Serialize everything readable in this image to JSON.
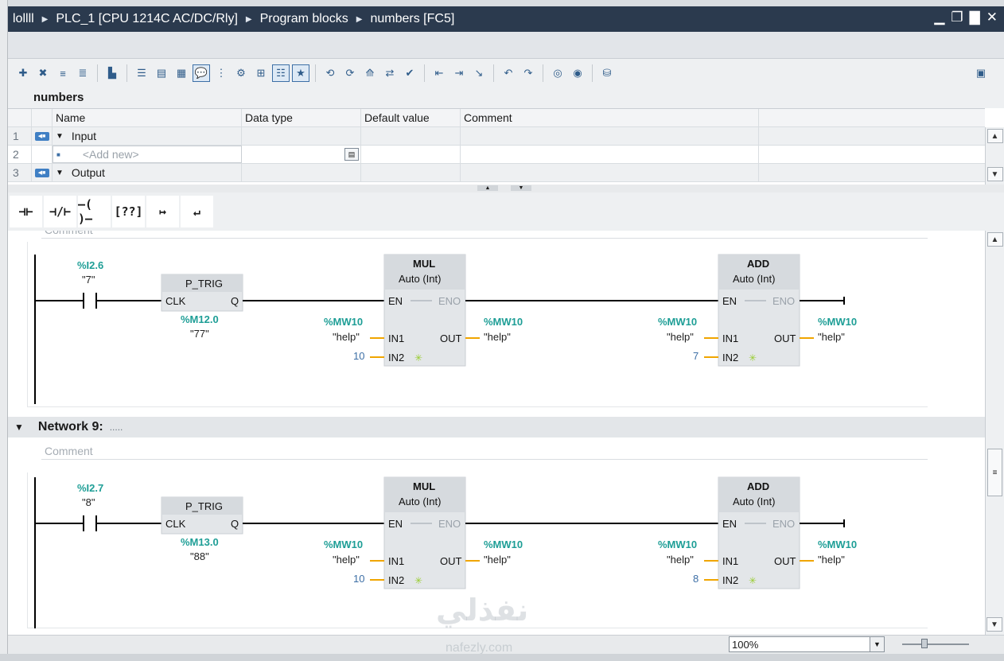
{
  "title_bar": {
    "crumbs": [
      "lollll",
      "PLC_1 [CPU 1214C AC/DC/Rly]",
      "Program blocks",
      "numbers [FC5]"
    ],
    "controls": [
      "▁",
      "❐",
      "▇",
      "✕"
    ]
  },
  "interface": {
    "block_name": "numbers",
    "columns": [
      "Name",
      "Data type",
      "Default value",
      "Comment"
    ],
    "rows": [
      {
        "num": "1",
        "name": "Input",
        "section": true
      },
      {
        "num": "2",
        "name": "<Add new>",
        "section": false
      },
      {
        "num": "3",
        "name": "Output",
        "section": true
      }
    ]
  },
  "favorites": [
    "⊣⊢",
    "⊣/⊢",
    "–( )–",
    "[??]",
    "↦",
    "↵"
  ],
  "network_top": {
    "comment": "Comment",
    "contact": {
      "address": "%I2.6",
      "tag": "\"7\""
    },
    "ptrig": {
      "title": "P_TRIG",
      "clk": "CLK",
      "q": "Q",
      "address": "%M12.0",
      "tag": "\"77\""
    },
    "mul": {
      "title": "MUL",
      "type": "Auto (Int)",
      "en": "EN",
      "eno": "ENO",
      "in1": "IN1",
      "in2": "IN2",
      "out": "OUT",
      "in1_addr": "%MW10",
      "in1_tag": "\"help\"",
      "in2_val": "10",
      "out_addr": "%MW10",
      "out_tag": "\"help\""
    },
    "add": {
      "title": "ADD",
      "type": "Auto (Int)",
      "en": "EN",
      "eno": "ENO",
      "in1": "IN1",
      "in2": "IN2",
      "out": "OUT",
      "in1_addr": "%MW10",
      "in1_tag": "\"help\"",
      "in2_val": "7",
      "out_addr": "%MW10",
      "out_tag": "\"help\""
    }
  },
  "network9": {
    "header": "Network 9:",
    "dots": ".....",
    "comment": "Comment",
    "contact": {
      "address": "%I2.7",
      "tag": "\"8\""
    },
    "ptrig": {
      "title": "P_TRIG",
      "clk": "CLK",
      "q": "Q",
      "address": "%M13.0",
      "tag": "\"88\""
    },
    "mul": {
      "title": "MUL",
      "type": "Auto (Int)",
      "en": "EN",
      "eno": "ENO",
      "in1": "IN1",
      "in2": "IN2",
      "out": "OUT",
      "in1_addr": "%MW10",
      "in1_tag": "\"help\"",
      "in2_val": "10",
      "out_addr": "%MW10",
      "out_tag": "\"help\""
    },
    "add": {
      "title": "ADD",
      "type": "Auto (Int)",
      "en": "EN",
      "eno": "ENO",
      "in1": "IN1",
      "in2": "IN2",
      "out": "OUT",
      "in1_addr": "%MW10",
      "in1_tag": "\"help\"",
      "in2_val": "8",
      "out_addr": "%MW10",
      "out_tag": "\"help\""
    }
  },
  "status": {
    "zoom": "100%"
  },
  "watermark": {
    "arabic": "نفذلي",
    "latin": "nafezly.com"
  },
  "colors": {
    "address": "#1e9e96",
    "constant": "#3d6fa6",
    "wire": "#f0a500",
    "titlebar": "#2b3a4e"
  }
}
